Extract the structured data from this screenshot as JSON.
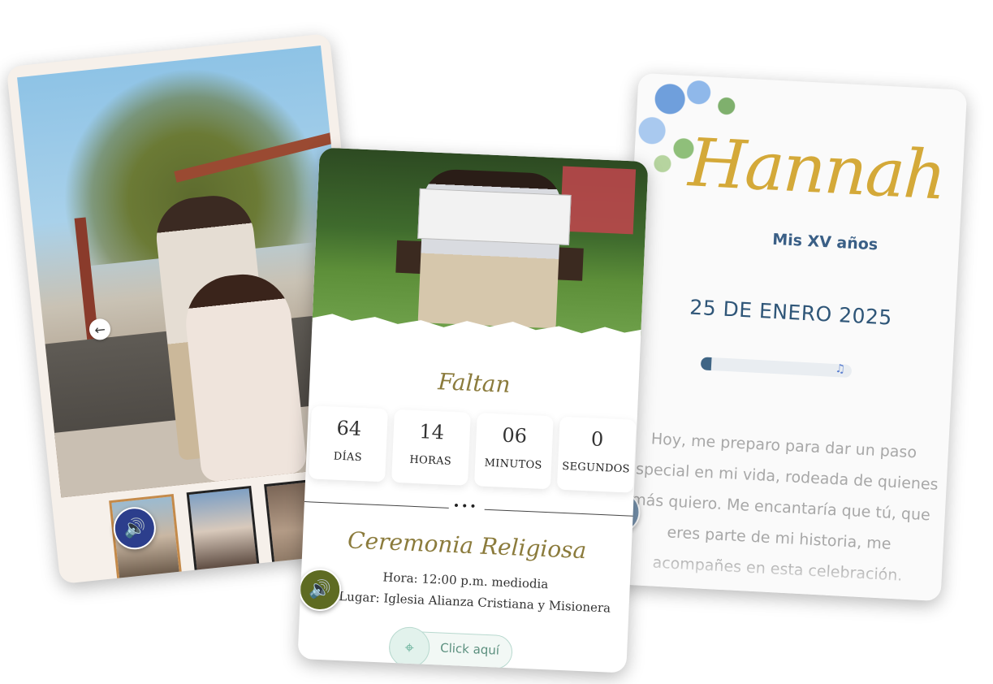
{
  "cards": {
    "left": {
      "prev_arrow": "←",
      "sound_icon": "🔊",
      "thumbnails": [
        {
          "id": "thumb-1"
        },
        {
          "id": "thumb-2"
        },
        {
          "id": "thumb-3"
        }
      ]
    },
    "middle": {
      "countdown_title": "Faltan",
      "countdown": [
        {
          "value": "64",
          "label": "DÍAS"
        },
        {
          "value": "14",
          "label": "HORAS"
        },
        {
          "value": "06",
          "label": "MINUTOS"
        },
        {
          "value": "0",
          "label": "SEGUNDOS"
        }
      ],
      "divider_dots": "•••",
      "event_title": "Ceremonia Religiosa",
      "event_time": "Hora: 12:00 p.m. mediodia",
      "event_place": "Lugar: Iglesia Alianza Cristiana y Misionera",
      "location_button": "Click aquí",
      "location_icon": "⌖",
      "sound_icon": "🔊"
    },
    "right": {
      "name": "Hannah",
      "subtitle": "Mis XV años",
      "date": "25 DE ENERO 2025",
      "music_icon": "♫",
      "player_progress": 0.07,
      "message": "Hoy, me preparo para dar un paso especial en mi vida, rodeada de quienes más quiero. Me encantaría que tú, que eres parte de mi historia, me acompañes en esta celebración.",
      "sound_icon": "🔊"
    }
  },
  "colors": {
    "gold": "#d4a939",
    "olive": "#8b7b3c",
    "navy": "#2f5678",
    "sound_blue": "#2c3e8c",
    "sound_olive": "#5e6b22"
  }
}
